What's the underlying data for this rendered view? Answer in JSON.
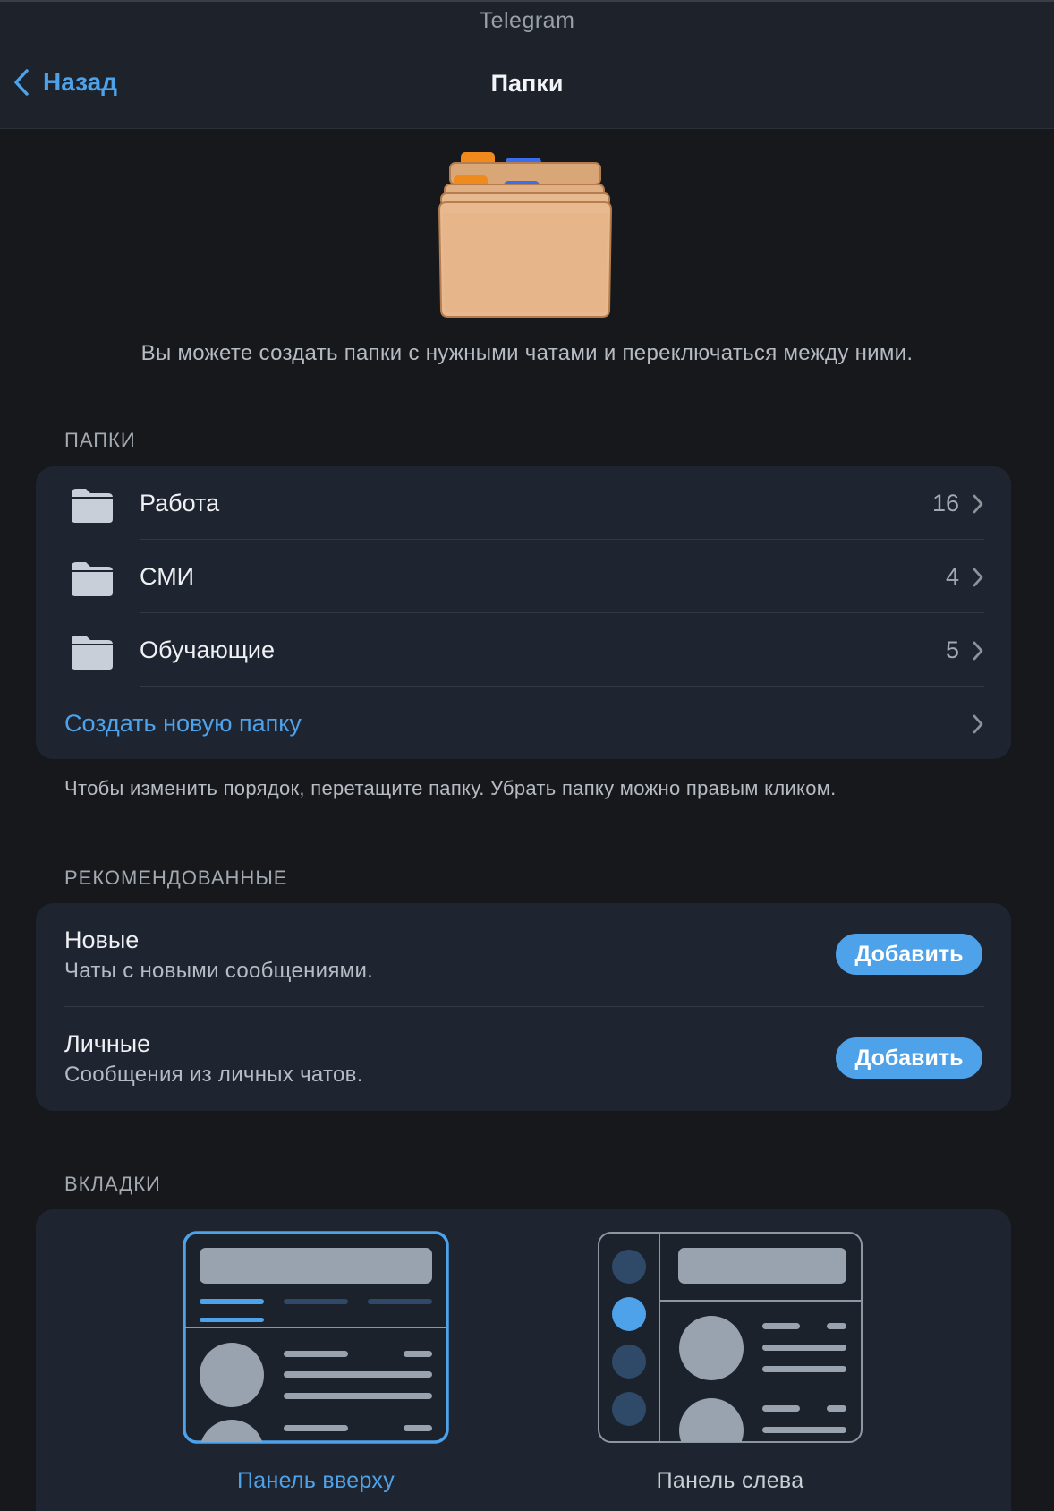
{
  "window": {
    "title": "Telegram"
  },
  "nav": {
    "back_label": "Назад",
    "title": "Папки"
  },
  "intro_text": "Вы можете создать папки с нужными чатами и переключаться между ними.",
  "folders": {
    "section_label": "ПАПКИ",
    "items": [
      {
        "name": "Работа",
        "count": "16"
      },
      {
        "name": "СМИ",
        "count": "4"
      },
      {
        "name": "Обучающие",
        "count": "5"
      }
    ],
    "create_label": "Создать новую папку",
    "hint": "Чтобы изменить порядок, перетащите папку. Убрать папку можно правым кликом."
  },
  "recommended": {
    "section_label": "РЕКОМЕНДОВАННЫЕ",
    "items": [
      {
        "title": "Новые",
        "subtitle": "Чаты с новыми сообщениями.",
        "button": "Добавить"
      },
      {
        "title": "Личные",
        "subtitle": "Сообщения из личных чатов.",
        "button": "Добавить"
      }
    ]
  },
  "tabs": {
    "section_label": "ВКЛАДКИ",
    "options": [
      {
        "label": "Панель вверху",
        "selected": true
      },
      {
        "label": "Панель слева",
        "selected": false
      }
    ]
  },
  "colors": {
    "accent": "#4ea2ea",
    "background": "#16181c",
    "card": "#1f2530",
    "icon_placeholder": "#99a2af",
    "icon_placeholder_dark": "#2e4a68"
  },
  "icons": {
    "back": "chevron-left-icon",
    "folder": "folder-icon",
    "disclosure": "chevron-right-icon",
    "hero": "folders-illustration-icon"
  }
}
